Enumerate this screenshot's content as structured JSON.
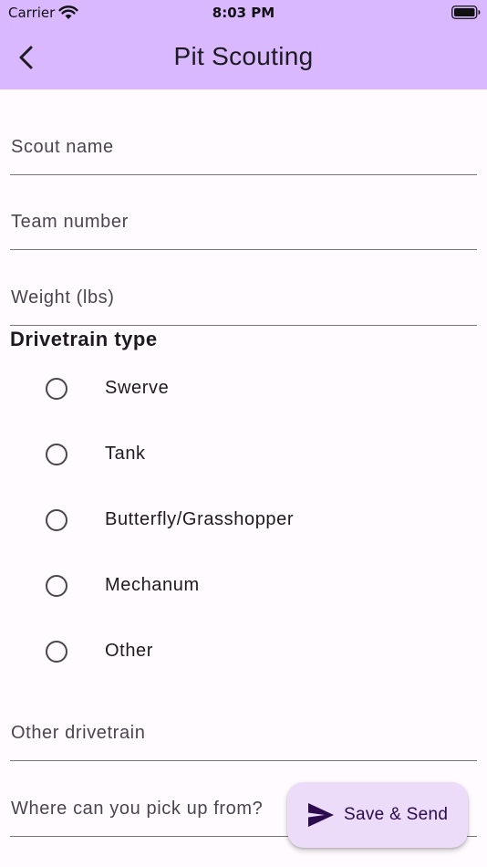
{
  "status_bar": {
    "carrier": "Carrier",
    "time": "8:03 PM",
    "wifi_icon": "wifi-icon",
    "battery_icon": "battery-icon"
  },
  "app_bar": {
    "title": "Pit Scouting",
    "back_icon": "chevron-left-icon",
    "background": "#d9b8ff"
  },
  "form": {
    "fields": [
      {
        "label": "Scout name",
        "value": ""
      },
      {
        "label": "Team number",
        "value": ""
      },
      {
        "label": "Weight (lbs)",
        "value": ""
      }
    ],
    "drivetrain": {
      "heading": "Drivetrain type",
      "options": [
        {
          "label": "Swerve",
          "selected": false
        },
        {
          "label": "Tank",
          "selected": false
        },
        {
          "label": "Butterfly/Grasshopper",
          "selected": false
        },
        {
          "label": "Mechanum",
          "selected": false
        },
        {
          "label": "Other",
          "selected": false
        }
      ]
    },
    "other_drivetrain": {
      "label": "Other drivetrain",
      "value": ""
    },
    "pickup": {
      "label": "Where can you pick up from?",
      "value": ""
    }
  },
  "fab": {
    "label": "Save & Send",
    "icon": "send-icon",
    "background": "#ecdcfa"
  }
}
